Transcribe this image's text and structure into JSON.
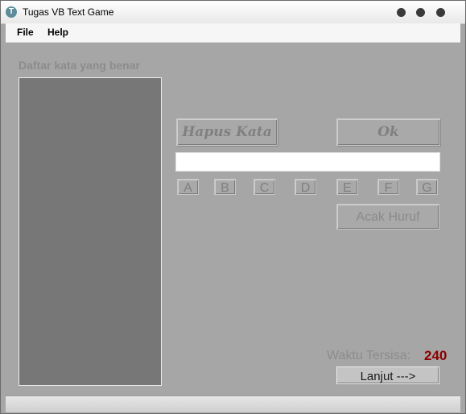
{
  "window": {
    "title": "Tugas VB Text Game",
    "icon": "app-logo-icon",
    "icon_letter": "T"
  },
  "menu": {
    "file": "File",
    "help": "Help"
  },
  "sidebar": {
    "label": "Daftar kata yang benar"
  },
  "buttons": {
    "delete_word": "Hapus Kata",
    "ok": "Ok",
    "shuffle": "Acak Huruf",
    "next": "Lanjut --->"
  },
  "input": {
    "value": ""
  },
  "letters": [
    "A",
    "B",
    "C",
    "D",
    "E",
    "F",
    "G"
  ],
  "timer": {
    "label": "Waktu Tersisa:",
    "value": "240"
  },
  "colors": {
    "background": "#a6a6a6",
    "list_background": "#777777",
    "timer_value": "#8b0000"
  }
}
